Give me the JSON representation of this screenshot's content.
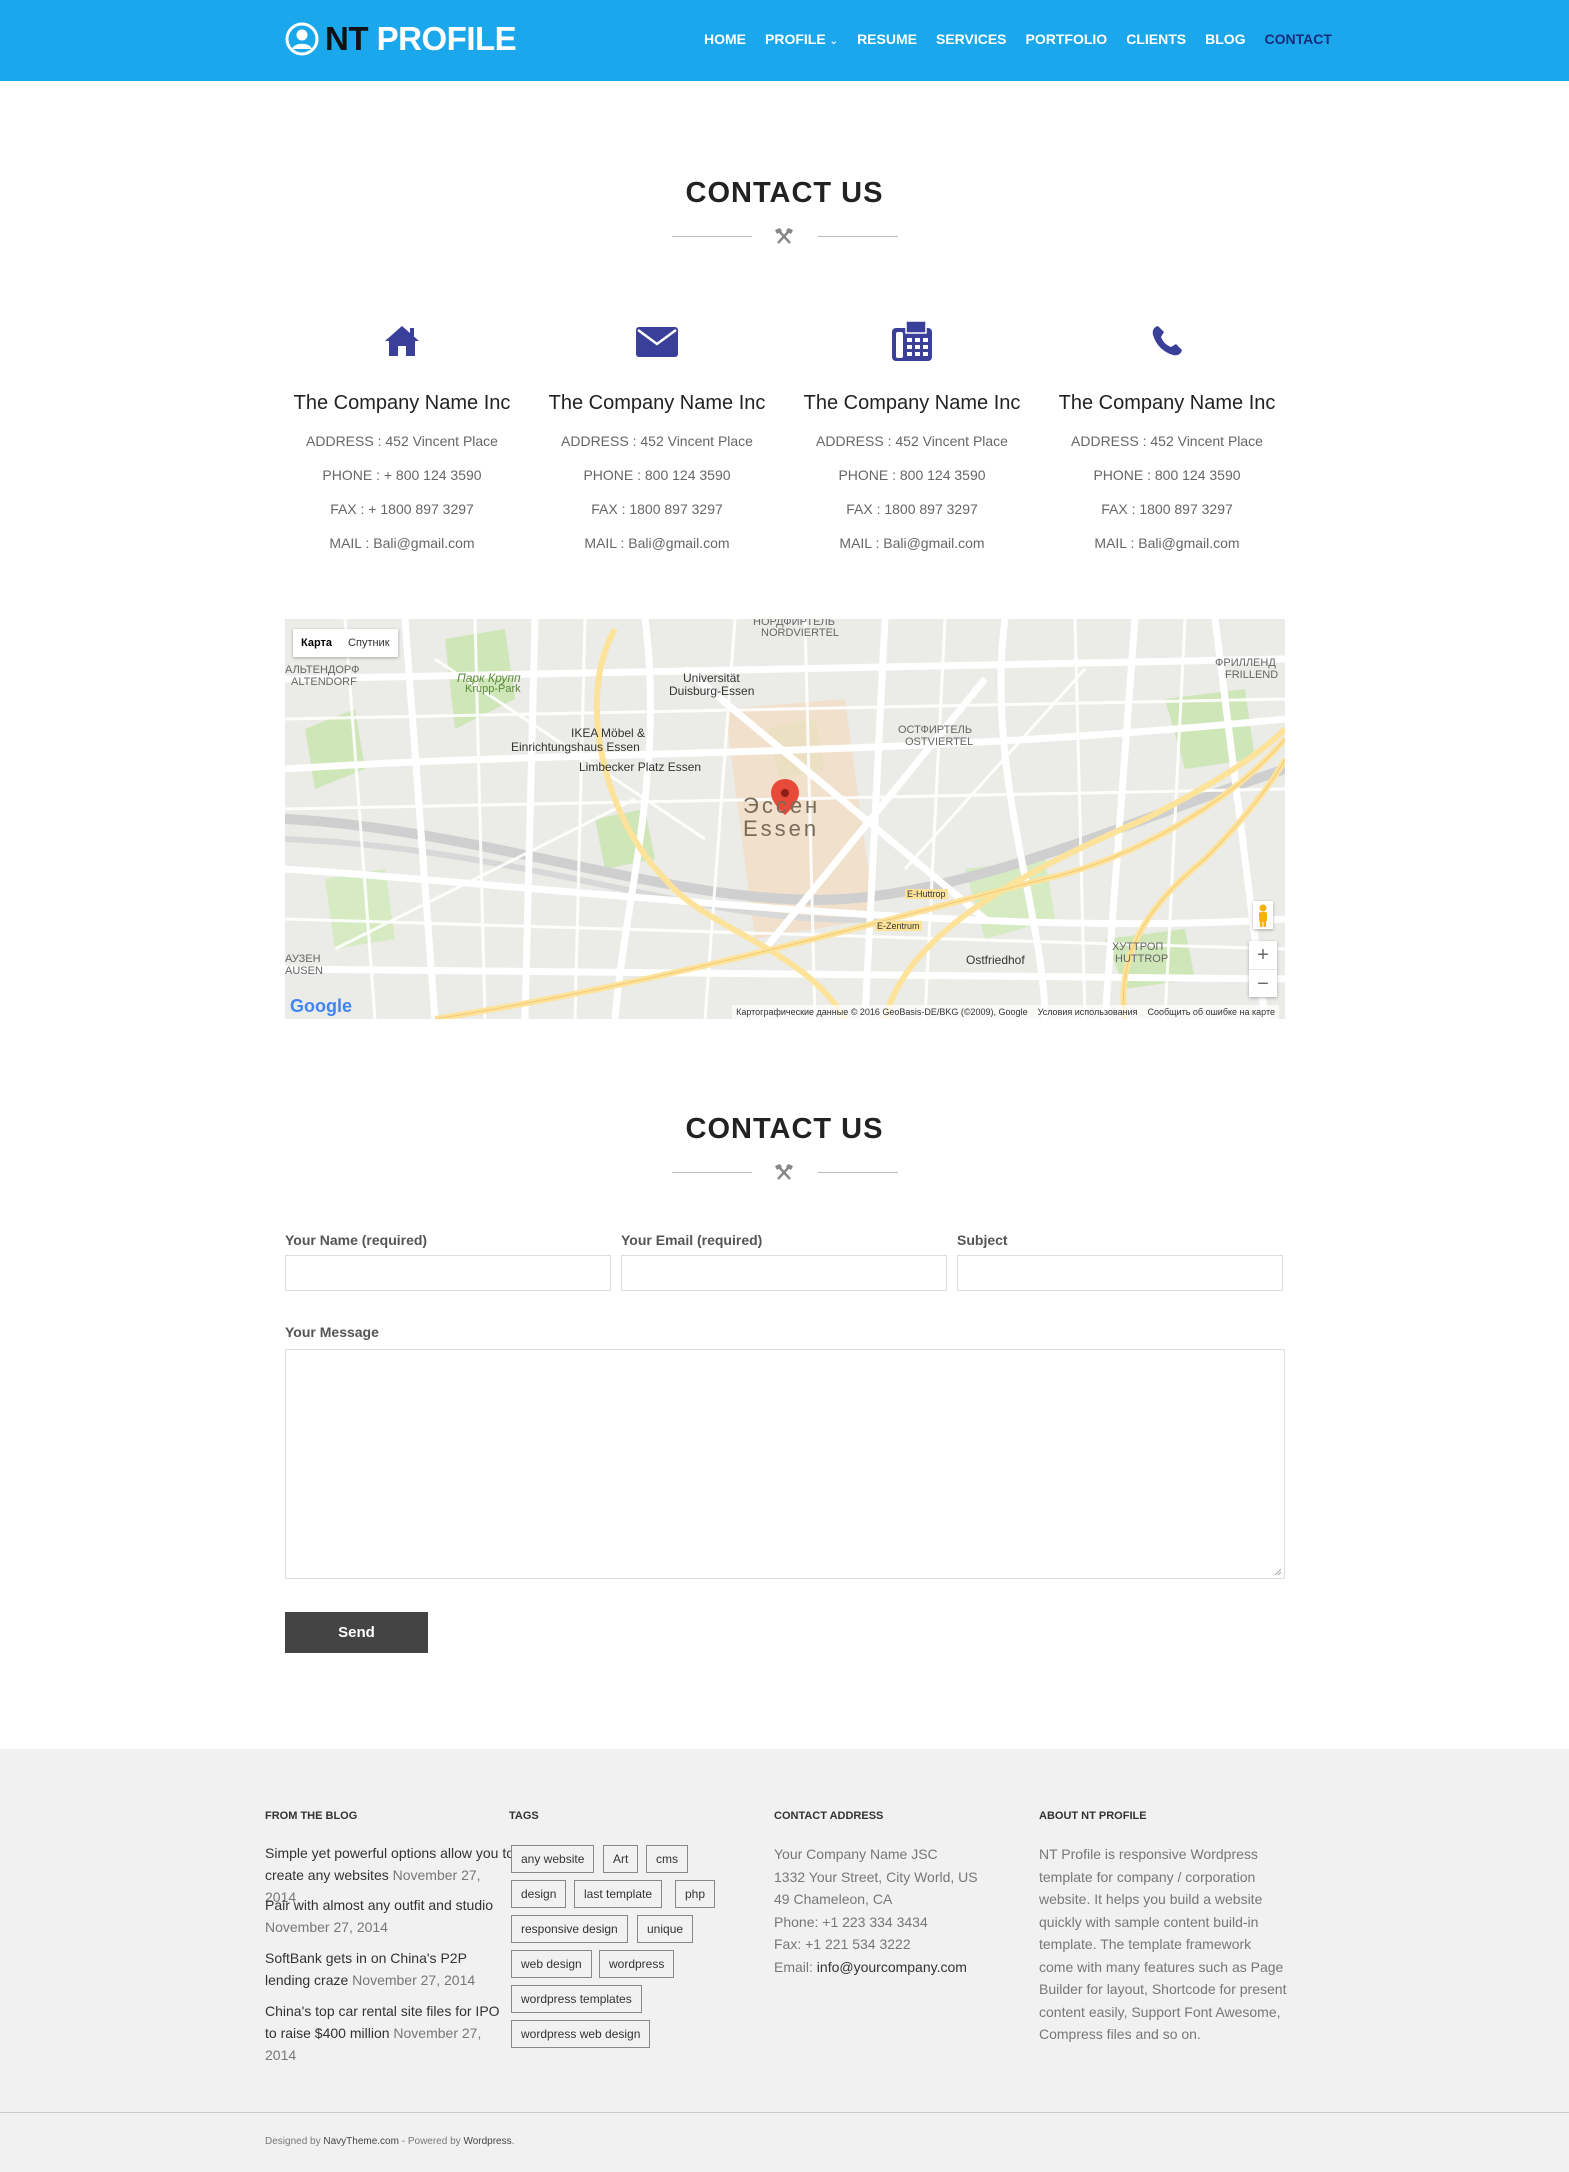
{
  "header": {
    "logo_nt": "NT",
    "logo_profile": "PROFILE",
    "nav": [
      {
        "label": "HOME"
      },
      {
        "label": "PROFILE"
      },
      {
        "label": "RESUME"
      },
      {
        "label": "SERVICES"
      },
      {
        "label": "PORTFOLIO"
      },
      {
        "label": "CLIENTS"
      },
      {
        "label": "BLOG"
      },
      {
        "label": "CONTACT"
      }
    ],
    "nav_active": "CONTACT",
    "bar_color": "#1aa7ec",
    "active_color": "#1a2a7a"
  },
  "contact_section": {
    "title": "CONTACT US",
    "icon_color": "#3a3f9a",
    "columns": [
      {
        "icon": "home-icon",
        "name": "The Company Name Inc",
        "address": "ADDRESS : 452 Vincent Place",
        "phone": "PHONE : + 800 124 3590",
        "fax": "FAX : + 1800 897 3297",
        "mail": "MAIL : Bali@gmail.com"
      },
      {
        "icon": "envelope-icon",
        "name": "The Company Name Inc",
        "address": "ADDRESS : 452 Vincent Place",
        "phone": "PHONE : 800 124 3590",
        "fax": "FAX : 1800 897 3297",
        "mail": "MAIL : Bali@gmail.com"
      },
      {
        "icon": "fax-icon",
        "name": "The Company Name Inc",
        "address": "ADDRESS : 452 Vincent Place",
        "phone": "PHONE : 800 124 3590",
        "fax": "FAX : 1800 897 3297",
        "mail": "MAIL : Bali@gmail.com"
      },
      {
        "icon": "phone-icon",
        "name": "The Company Name Inc",
        "address": "ADDRESS : 452 Vincent Place",
        "phone": "PHONE : 800 124 3590",
        "fax": "FAX : 1800 897 3297",
        "mail": "MAIL : Bali@gmail.com"
      }
    ]
  },
  "map": {
    "type_map": "Карта",
    "type_satellite": "Спутник",
    "zoom_in": "+",
    "zoom_out": "−",
    "google": "Google",
    "attribution": "Картографические данные © 2016 GeoBasis-DE/BKG (©2009), Google",
    "terms": "Условия использования",
    "report": "Сообщить об ошибке на карте",
    "labels": {
      "city_ru": "Эссен",
      "city_de": "Essen",
      "nordviertel_ru": "НОРДФИРТЕЛЬ",
      "nordviertel": "NORDVIERTEL",
      "uni": "Universität",
      "uni2": "Duisburg-Essen",
      "ikea": "IKEA Möbel &",
      "ikea2": "Einrichtungshaus Essen",
      "limbecker": "Limbecker Platz Essen",
      "altendorf_ru": "АЛЬТЕНДОРФ",
      "altendorf": "ALTENDORF",
      "krupp_ru": "Парк Крупп",
      "krupp": "Krupp-Park",
      "ostviertel_ru": "ОСТФИРТЕЛЬ",
      "ostviertel": "OSTVIERTEL",
      "frillend_ru": "ФРИЛЛЕНД",
      "frillend": "FRILLEND",
      "huttrop_ru": "ХУТТРОП",
      "huttrop": "HUTTROP",
      "ostfriedhof": "Ostfriedhof",
      "ehuttrop": "E-Huttrop",
      "ezentrum": "E-Zentrum",
      "auzen": "АУЗЕН",
      "ausen": "AUSEN"
    }
  },
  "form_section": {
    "title": "CONTACT US",
    "name_label": "Your Name (required)",
    "email_label": "Your Email (required)",
    "subject_label": "Subject",
    "message_label": "Your Message",
    "name_value": "",
    "email_value": "",
    "subject_value": "",
    "message_value": "",
    "send_label": "Send"
  },
  "footer": {
    "blog_title": "FROM THE BLOG",
    "blog_posts": [
      {
        "title": "Simple yet powerful options allow you to create any websites",
        "date": "November 27, 2014"
      },
      {
        "title": "Pair with almost any outfit and studio",
        "date": "November 27, 2014"
      },
      {
        "title": "SoftBank gets in on China's P2P lending craze",
        "date": "November 27, 2014"
      },
      {
        "title": "China's top car rental site files for IPO to raise $400 million",
        "date": "November 27, 2014"
      }
    ],
    "tags_title": "TAGS",
    "tags": [
      "any website",
      "Art",
      "cms",
      "design",
      "last template",
      "php",
      "responsive design",
      "unique",
      "web design",
      "wordpress",
      "wordpress templates",
      "wordpress web design"
    ],
    "contact_title": "CONTACT ADDRESS",
    "contact_lines": [
      "Your Company Name JSC",
      "1332 Your Street, City World, US",
      "49 Chameleon, CA",
      "Phone: +1 223 334 3434",
      "Fax: +1 221 534 3222"
    ],
    "contact_email_prefix": "Email: ",
    "contact_email": "info@yourcompany.com",
    "about_title": "ABOUT NT PROFILE",
    "about_text": "NT Profile is responsive Wordpress template for company / corporation website. It helps you build a website quickly with sample content build-in template. The template framework come with many features such as Page Builder for layout, Shortcode for present content easily, Support Font Awesome, Compress files and so on.",
    "credits_prefix": "Designed by ",
    "credits_designer": "NavyTheme.com",
    "credits_mid": " - Powered by ",
    "credits_powered": "Wordpress",
    "credits_end": "."
  }
}
